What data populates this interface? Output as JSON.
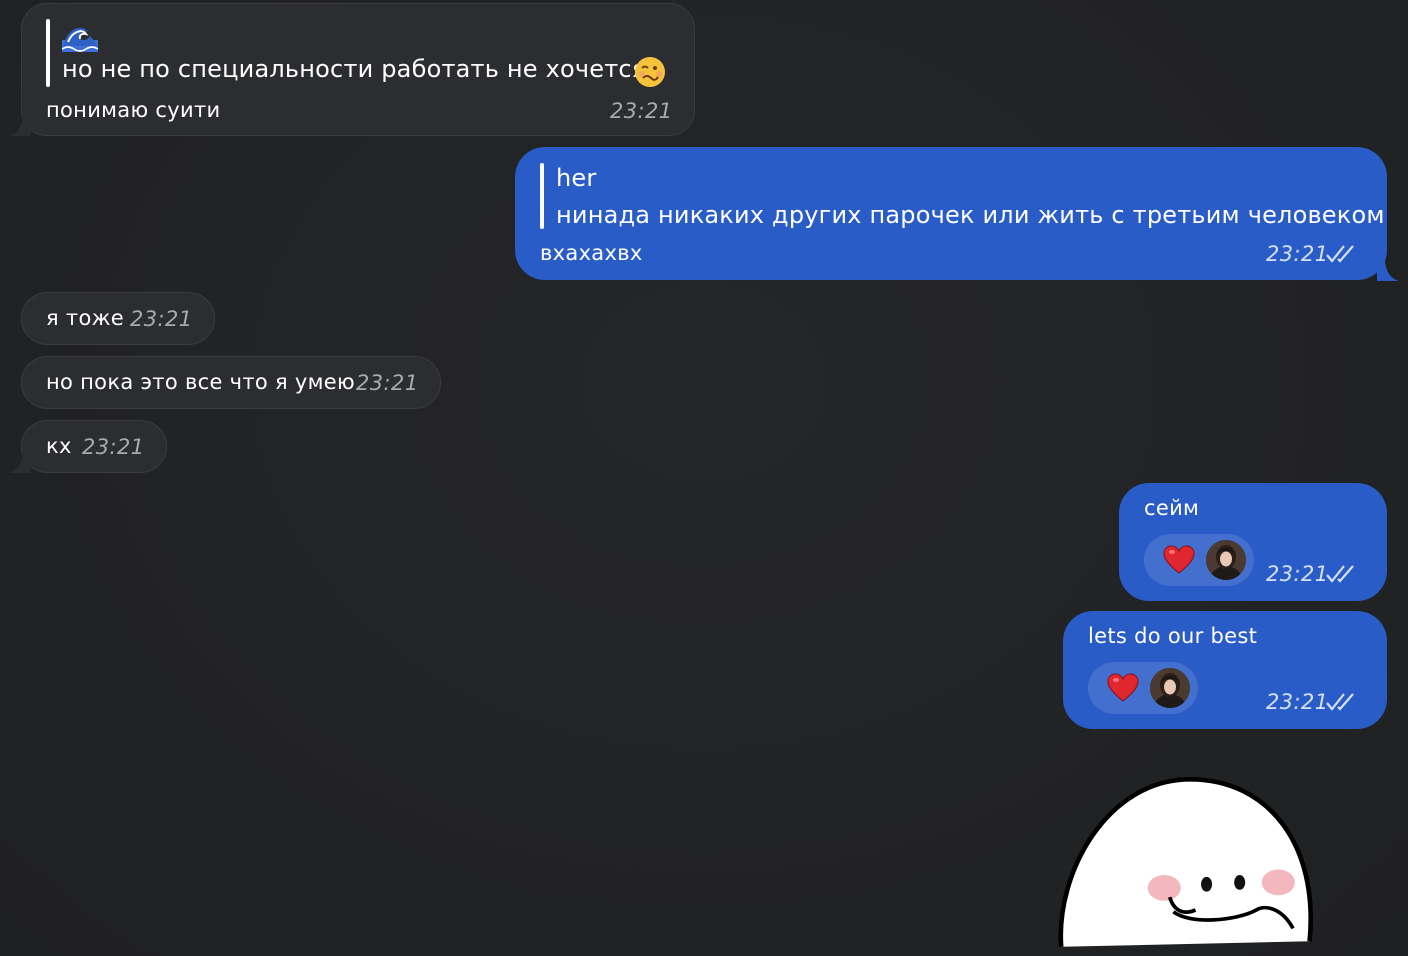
{
  "messages": [
    {
      "direction": "incoming",
      "reply_icon": "wave-emoji",
      "reply_text": "но не по специальности работать не хочется",
      "reply_emoji": "woozy-face-emoji",
      "text": "понимаю суити",
      "time": "23:21"
    },
    {
      "direction": "outgoing",
      "reply_author": "her",
      "reply_text": "нинада никаких других парочек или жить с третьим человеком",
      "text": "вхахахвх",
      "time": "23:21",
      "status_icon": "double-check-icon"
    },
    {
      "direction": "incoming",
      "text": "я тоже",
      "time": "23:21"
    },
    {
      "direction": "incoming",
      "text": "но пока это все что я умею",
      "time": "23:21"
    },
    {
      "direction": "incoming",
      "text": "кх",
      "time": "23:21"
    },
    {
      "direction": "outgoing",
      "text": "сейм",
      "time": "23:21",
      "reaction_icon": "red-heart-icon",
      "status_icon": "double-check-icon"
    },
    {
      "direction": "outgoing",
      "text": "lets do our best",
      "time": "23:21",
      "reaction_icon": "red-heart-icon",
      "status_icon": "double-check-icon"
    }
  ],
  "sticker": {
    "icon": "blushing-white-blob-sticker"
  },
  "colors": {
    "background": "#222325",
    "incoming_bubble": "#2c2d30",
    "outgoing_bubble": "#2a5cc8",
    "heart": "#e0262f"
  }
}
